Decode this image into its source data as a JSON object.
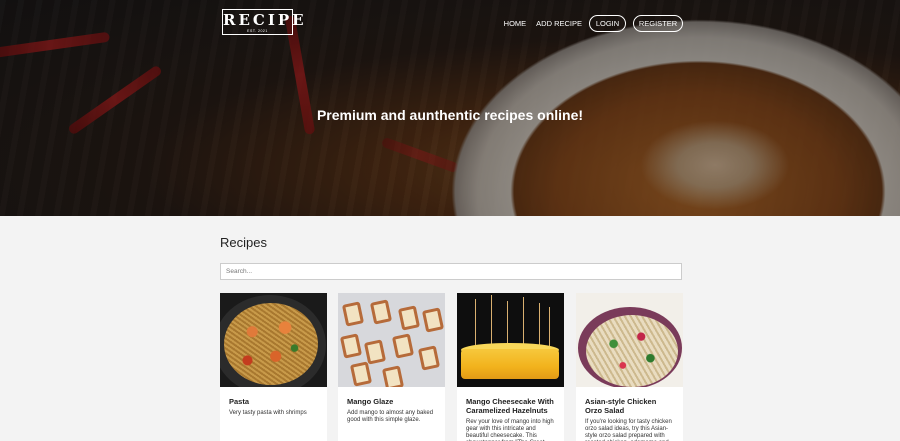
{
  "header": {
    "logo_word": "RECIPE",
    "logo_est": "EST. 2021",
    "nav": {
      "home": "HOME",
      "add_recipe": "ADD RECIPE",
      "login": "LOGIN",
      "register": "REGISTER"
    },
    "tagline": "Premium and aunthentic recipes online!"
  },
  "main": {
    "section_title": "Recipes",
    "search_placeholder": "Search..."
  },
  "recipes": [
    {
      "title": "Pasta",
      "desc": "Very tasty pasta with shrimps",
      "image": "pasta-photo"
    },
    {
      "title": "Mango Glaze",
      "desc": "Add mango to almost any baked good with this simple glaze.",
      "image": "mango-glaze-photo"
    },
    {
      "title": "Mango Cheesecake With Caramelized Hazelnuts",
      "desc": "Rev your love of mango into high gear with this intricate and beautiful cheesecake. This showstopper from \"The Great",
      "image": "cheesecake-photo"
    },
    {
      "title": "Asian-style Chicken Orzo Salad",
      "desc": "If you're looking for tasty chicken orzo salad ideas, try this Asian-style orzo salad prepared with roasted chicken, edamame and",
      "image": "salad-photo"
    }
  ]
}
